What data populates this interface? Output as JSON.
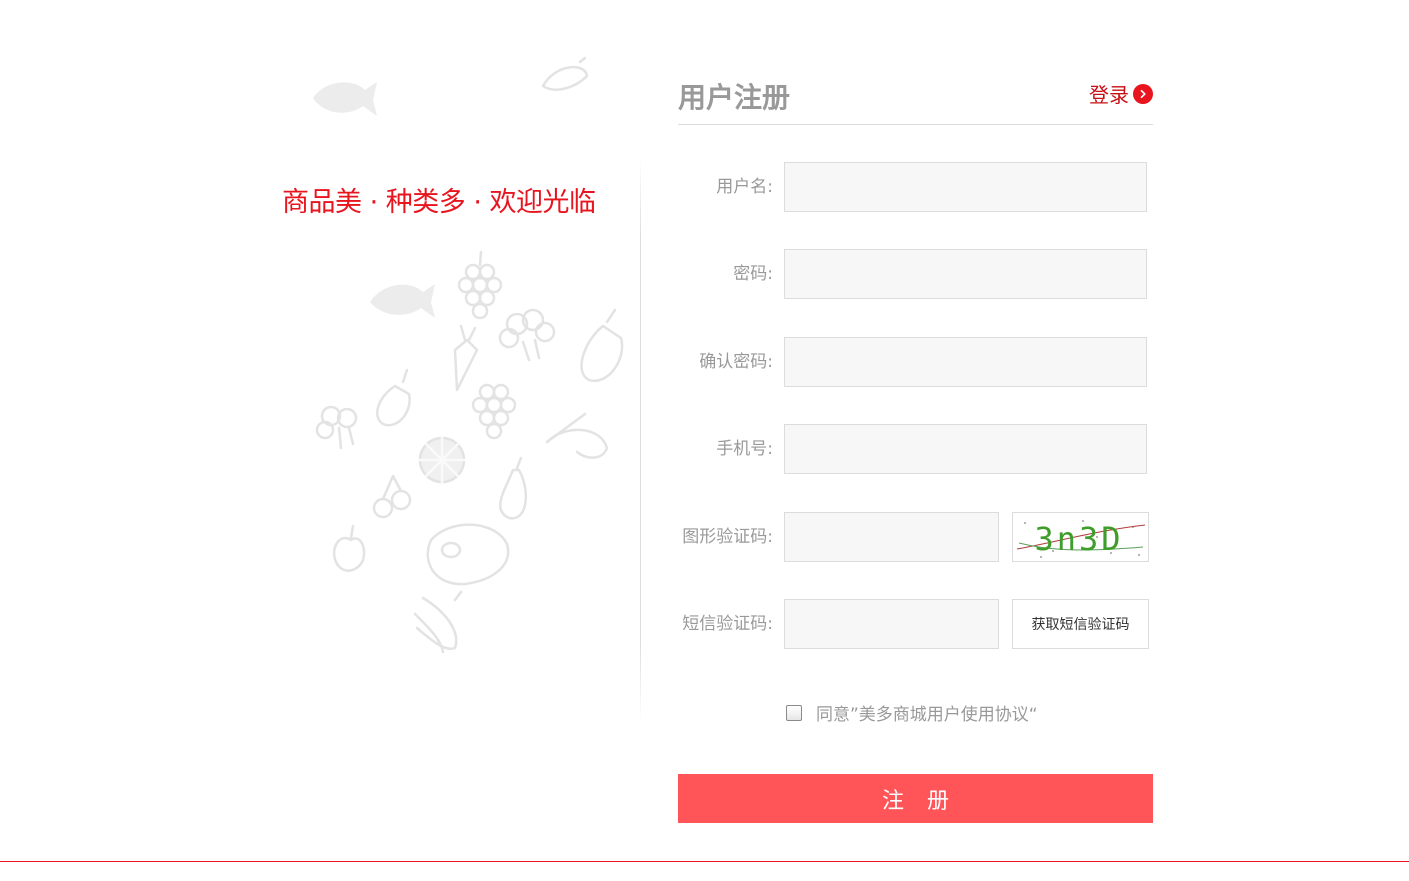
{
  "left": {
    "slogan": "商品美 · 种类多 · 欢迎光临"
  },
  "header": {
    "title": "用户注册",
    "login_label": "登录"
  },
  "form": {
    "fields": [
      {
        "label": "用户名:",
        "value": "",
        "placeholder": ""
      },
      {
        "label": "密码:",
        "value": "",
        "placeholder": ""
      },
      {
        "label": "确认密码:",
        "value": "",
        "placeholder": ""
      },
      {
        "label": "手机号:",
        "value": "",
        "placeholder": ""
      }
    ],
    "captcha": {
      "label": "图形验证码:",
      "value": "",
      "image_text": "3n3D"
    },
    "sms": {
      "label": "短信验证码:",
      "value": "",
      "button_label": "获取短信验证码"
    },
    "agreement": {
      "text": "同意”美多商城用户使用协议“",
      "checked": false
    },
    "submit_label": "注 册"
  },
  "colors": {
    "accent": "#e8141e",
    "button": "#ff5558",
    "label": "#999999",
    "input_bg": "#f7f7f7"
  },
  "icons": [
    "fish-icon",
    "banana-icon",
    "grape-icon",
    "carrot-icon",
    "broccoli-icon",
    "eggplant-icon",
    "shrimp-icon",
    "lemon-icon",
    "cherry-icon",
    "apple-icon",
    "steak-icon",
    "arrow-right-icon"
  ]
}
